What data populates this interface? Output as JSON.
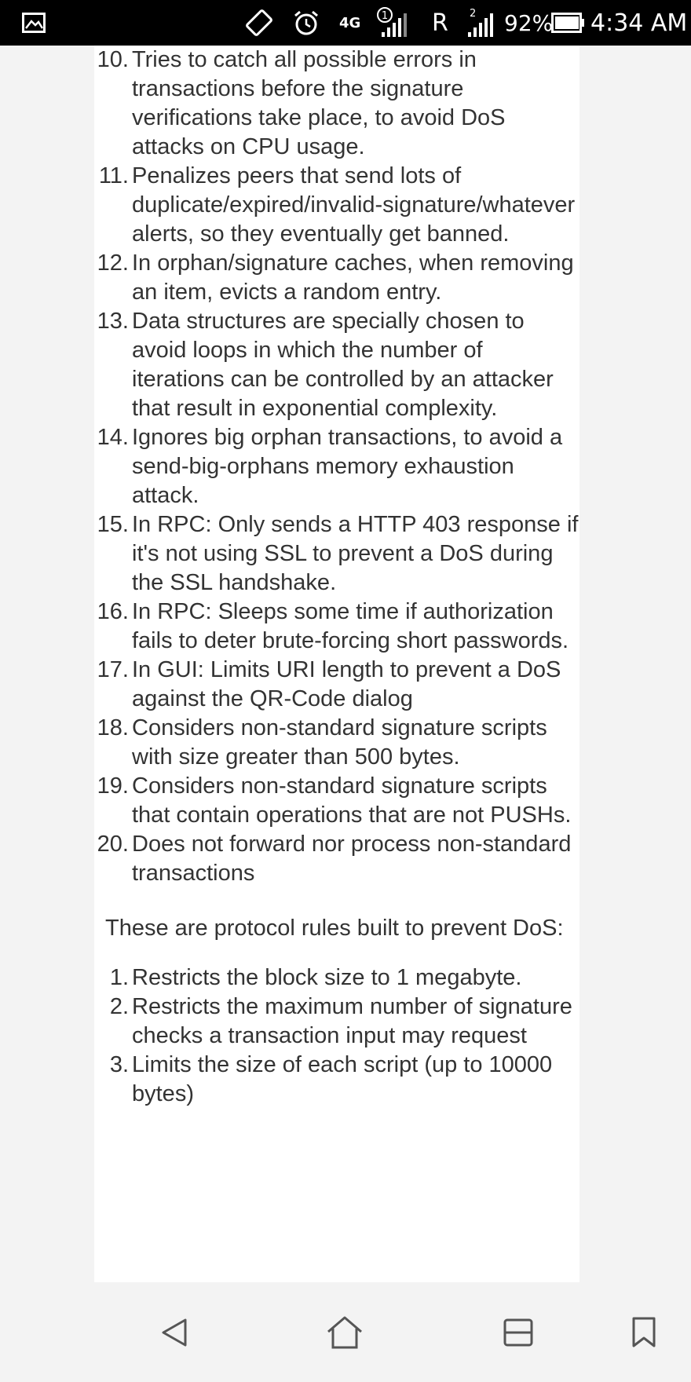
{
  "status_bar": {
    "network_type": "4G",
    "roaming_indicator": "R",
    "battery_percent": "92%",
    "time": "4:34 AM",
    "icons": [
      "notification-icon",
      "screen-rotate-icon",
      "alarm-icon",
      "sim1-signal-icon",
      "sim2-signal-icon",
      "battery-icon"
    ]
  },
  "article": {
    "dos_measures": [
      {
        "num": "10.",
        "text": "Tries to catch all possible errors in transactions before the signature verifications take place, to avoid DoS attacks on CPU usage."
      },
      {
        "num": "11.",
        "text": "Penalizes peers that send lots of duplicate/expired/invalid-signature/whatever alerts, so they eventually get banned."
      },
      {
        "num": "12.",
        "text": "In orphan/signature caches, when removing an item, evicts a random entry."
      },
      {
        "num": "13.",
        "text": "Data structures are specially chosen to avoid loops in which the number of iterations can be controlled by an attacker that result in exponential complexity."
      },
      {
        "num": "14.",
        "text": "Ignores big orphan transactions, to avoid a send-big-orphans memory exhaustion attack."
      },
      {
        "num": "15.",
        "text": "In RPC: Only sends a HTTP 403 response if it's not using SSL to prevent a DoS during the SSL handshake."
      },
      {
        "num": "16.",
        "text": "In RPC: Sleeps some time if authorization fails to deter brute-forcing short passwords."
      },
      {
        "num": "17.",
        "text": "In GUI: Limits URI length to prevent a DoS against the QR-Code dialog"
      },
      {
        "num": "18.",
        "text": "Considers non-standard signature scripts with size greater than 500 bytes."
      },
      {
        "num": "19.",
        "text": "Considers non-standard signature scripts that contain operations that are not PUSHs."
      },
      {
        "num": "20.",
        "text": "Does not forward nor process non-standard transactions"
      }
    ],
    "protocol_intro": "These are protocol rules built to prevent DoS:",
    "protocol_rules": [
      {
        "num": "1.",
        "text": "Restricts the block size to 1 megabyte."
      },
      {
        "num": "2.",
        "text": "Restricts the maximum number of signature checks a transaction input may request"
      },
      {
        "num": "3.",
        "text": "Limits the size of each script (up to 10000 bytes)"
      }
    ]
  },
  "nav_bar": {
    "buttons": [
      "back-icon",
      "home-icon",
      "recents-icon",
      "bookmark-icon"
    ]
  }
}
